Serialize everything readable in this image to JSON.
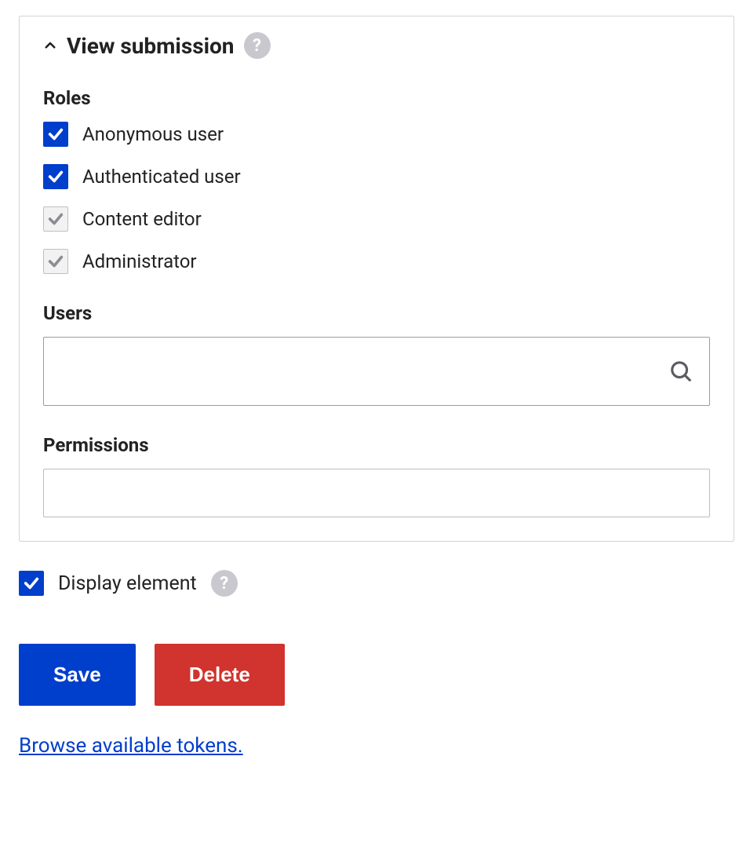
{
  "panel": {
    "title": "View submission",
    "help_symbol": "?",
    "roles": {
      "label": "Roles",
      "items": [
        {
          "label": "Anonymous user",
          "state": "active"
        },
        {
          "label": "Authenticated user",
          "state": "active"
        },
        {
          "label": "Content editor",
          "state": "disabled"
        },
        {
          "label": "Administrator",
          "state": "disabled"
        }
      ]
    },
    "users": {
      "label": "Users",
      "value": ""
    },
    "permissions": {
      "label": "Permissions",
      "value": ""
    }
  },
  "display_element": {
    "label": "Display element",
    "help_symbol": "?"
  },
  "buttons": {
    "save": "Save",
    "delete": "Delete"
  },
  "tokens_link": "Browse available tokens."
}
